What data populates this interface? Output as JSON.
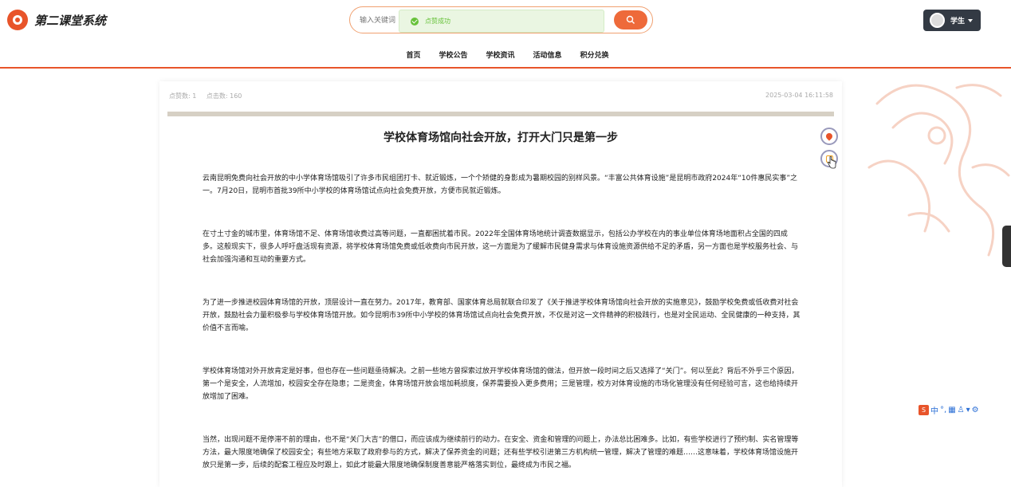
{
  "app": {
    "title": "第二课堂系统"
  },
  "search": {
    "placeholder": "输入关键词"
  },
  "toast": {
    "message": "点赞成功"
  },
  "user": {
    "name": "学生"
  },
  "nav": [
    {
      "label": "首页"
    },
    {
      "label": "学校公告"
    },
    {
      "label": "学校资讯"
    },
    {
      "label": "活动信息"
    },
    {
      "label": "积分兑换"
    }
  ],
  "article": {
    "likes_label": "点赞数: 1",
    "clicks_label": "点击数: 160",
    "date": "2025-03-04 16:11:58",
    "title": "学校体育场馆向社会开放，打开大门只是第一步",
    "paragraphs": [
      "云南昆明免费向社会开放的中小学体育场馆吸引了许多市民组团打卡、就近锻炼，一个个矫健的身影成为暑期校园的别样风景。“丰富公共体育设施”是昆明市政府2024年“10件惠民实事”之一。7月20日，昆明市首批39所中小学校的体育场馆试点向社会免费开放，方便市民就近锻炼。",
      "在寸土寸金的城市里，体育场馆不足、体育场馆收费过高等问题，一直都困扰着市民。2022年全国体育场地统计调查数据显示，包括公办学校在内的事业单位体育场地面积占全国的四成多。这般现实下，很多人呼吁盘活现有资源，将学校体育场馆免费或低收费向市民开放，这一方面是为了缓解市民健身需求与体育设施资源供给不足的矛盾，另一方面也是学校服务社会、与社会加强沟通和互动的重要方式。",
      "为了进一步推进校园体育场馆的开放，顶层设计一直在努力。2017年，教育部、国家体育总局就联合印发了《关于推进学校体育场馆向社会开放的实施意见》，鼓励学校免费或低收费对社会开放，鼓励社会力量积极参与学校体育场馆开放。如今昆明市39所中小学校的体育场馆试点向社会免费开放，不仅是对这一文件精神的积极践行，也是对全民运动、全民健康的一种支持，其价值不言而喻。",
      "学校体育场馆对外开放肯定是好事，但也存在一些问题亟待解决。之前一些地方曾探索过放开学校体育场馆的做法，但开放一段时间之后又选择了“关门”。何以至此？背后不外乎三个原因，第一个是安全，人流增加，校园安全存在隐患；二是资金，体育场馆开放会增加耗损度，保养需要投入更多费用；三是管理，校方对体育设施的市场化管理没有任何经验可言，这也给持续开放增加了困难。",
      "当然，出现问题不是停滞不前的理由，也不是“关门大吉”的借口，而应该成为继续前行的动力。在安全、资金和管理的问题上，办法总比困难多。比如，有些学校进行了预约制、实名管理等方法，最大限度地确保了校园安全；有些地方采取了政府参与的方式，解决了保养资金的问题；还有些学校引进第三方机构统一管理，解决了管理的难题……这意味着，学校体育场馆设施开放只是第一步，后续的配套工程应及时跟上，如此才能最大限度地确保制度善意能严格落实到位，最终成为市民之福。"
    ]
  },
  "ime": {
    "labels": [
      "中",
      "°,",
      "▦",
      "♙",
      "▾",
      "⚙"
    ]
  },
  "colors": {
    "accent": "#e8542a",
    "toast_bg": "#eaf6e2",
    "toast_text": "#67c23a",
    "user_bg": "#333a44"
  }
}
